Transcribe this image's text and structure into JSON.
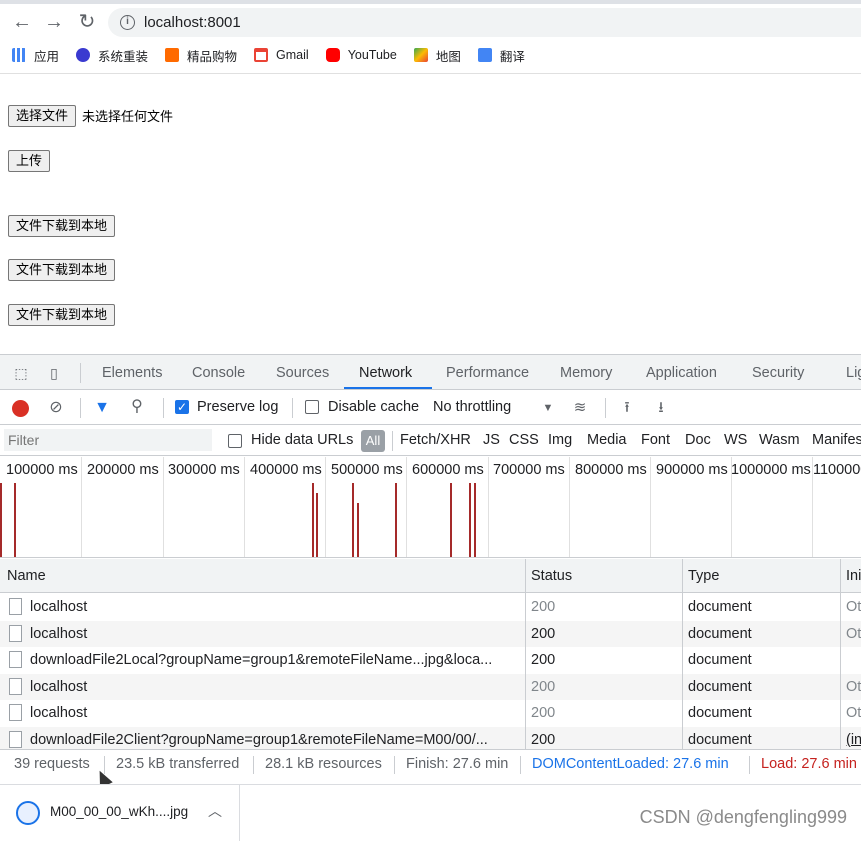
{
  "browser": {
    "url": "localhost:8001",
    "bookmarks": [
      {
        "label": "应用",
        "icon": "apps-grid-icon",
        "color": "#1a73e8"
      },
      {
        "label": "系统重装",
        "icon": "system-icon",
        "color": "#3a3ad0"
      },
      {
        "label": "精品购物",
        "icon": "taobao-icon",
        "color": "#ff6a00"
      },
      {
        "label": "Gmail",
        "icon": "gmail-icon",
        "color": "#ea4335"
      },
      {
        "label": "YouTube",
        "icon": "youtube-icon",
        "color": "#ff0000"
      },
      {
        "label": "地图",
        "icon": "maps-icon",
        "color": "#34a853"
      },
      {
        "label": "翻译",
        "icon": "translate-icon",
        "color": "#4285f4"
      }
    ]
  },
  "page": {
    "choose_file_label": "选择文件",
    "no_file_text": "未选择任何文件",
    "upload_label": "上传",
    "download_labels": [
      "文件下载到本地",
      "文件下载到本地",
      "文件下载到本地"
    ]
  },
  "devtools": {
    "tabs": [
      "Elements",
      "Console",
      "Sources",
      "Network",
      "Performance",
      "Memory",
      "Application",
      "Security",
      "Lig"
    ],
    "active_tab": "Network",
    "toolbar": {
      "preserve_log": "Preserve log",
      "disable_cache": "Disable cache",
      "throttling": "No throttling"
    },
    "filter": {
      "placeholder": "Filter",
      "hide_data_urls": "Hide data URLs",
      "types": [
        "All",
        "Fetch/XHR",
        "JS",
        "CSS",
        "Img",
        "Media",
        "Font",
        "Doc",
        "WS",
        "Wasm",
        "Manifes"
      ]
    },
    "overview_ticks": [
      "100000 ms",
      "200000 ms",
      "300000 ms",
      "400000 ms",
      "500000 ms",
      "600000 ms",
      "700000 ms",
      "800000 ms",
      "900000 ms",
      "1000000 ms",
      "1100000"
    ],
    "columns": [
      "Name",
      "Status",
      "Type",
      "Ini"
    ],
    "rows": [
      {
        "name": "localhost",
        "status": "200",
        "type": "document",
        "initiator": "Ot"
      },
      {
        "name": "localhost",
        "status": "200",
        "type": "document",
        "initiator": "Ot"
      },
      {
        "name": "downloadFile2Local?groupName=group1&remoteFileName...jpg&loca...",
        "status": "200",
        "type": "document",
        "initiator": ""
      },
      {
        "name": "localhost",
        "status": "200",
        "type": "document",
        "initiator": "Ot"
      },
      {
        "name": "localhost",
        "status": "200",
        "type": "document",
        "initiator": "Ot"
      },
      {
        "name": "downloadFile2Client?groupName=group1&remoteFileName=M00/00/...",
        "status": "200",
        "type": "document",
        "initiator": "(in"
      }
    ],
    "summary": {
      "requests": "39 requests",
      "transferred": "23.5 kB transferred",
      "resources": "28.1 kB resources",
      "finish": "Finish: 27.6 min",
      "dom_loaded": "DOMContentLoaded: 27.6 min",
      "load": "Load: 27.6 min"
    }
  },
  "download": {
    "filename": "M00_00_00_wKh....jpg"
  },
  "watermark": "CSDN @dengfengling999"
}
